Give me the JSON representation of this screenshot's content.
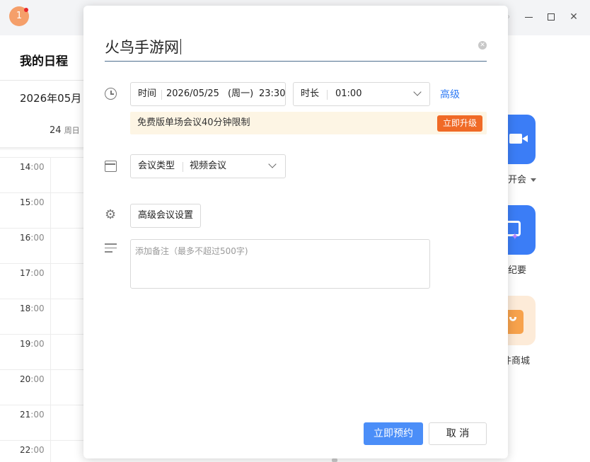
{
  "app": {
    "badge": "1",
    "schedule_title": "我的日程",
    "month": "2026年05月",
    "day_number": "24",
    "day_weekday": "周日",
    "hours": [
      {
        "hh": "14",
        "mm": ":00"
      },
      {
        "hh": "15",
        "mm": ":00"
      },
      {
        "hh": "16",
        "mm": ":00"
      },
      {
        "hh": "17",
        "mm": ":00"
      },
      {
        "hh": "18",
        "mm": ":00"
      },
      {
        "hh": "19",
        "mm": ":00"
      },
      {
        "hh": "20",
        "mm": ":00"
      },
      {
        "hh": "21",
        "mm": ":00"
      },
      {
        "hh": "22",
        "mm": ":00"
      }
    ],
    "side_apps": [
      {
        "label": "开会",
        "icon": "video-camera-icon"
      },
      {
        "label": "纪要",
        "icon": "notes-sparkle-icon"
      },
      {
        "label": "件商城",
        "icon": "shopping-bag-icon"
      }
    ],
    "colors": {
      "accent": "#4b8ef8",
      "upgrade": "#f06a26",
      "notice_bg": "#fdf5e4",
      "app_blue": "#3b7df6"
    }
  },
  "dialog": {
    "title_value": "火鸟手游网",
    "time": {
      "label": "时间",
      "date": "2026/05/25",
      "weekday": "(周一)",
      "clock": "23:30"
    },
    "duration": {
      "label": "时长",
      "value": "01:00"
    },
    "advanced_link": "高级",
    "notice": {
      "text": "免费版单场会议40分钟限制",
      "button": "立即升级"
    },
    "meeting_type": {
      "label": "会议类型",
      "value": "视频会议"
    },
    "advanced_settings": "高级会议设置",
    "remark_placeholder": "添加备注（最多不超过500字)",
    "confirm": "立即预约",
    "cancel": "取 消"
  }
}
